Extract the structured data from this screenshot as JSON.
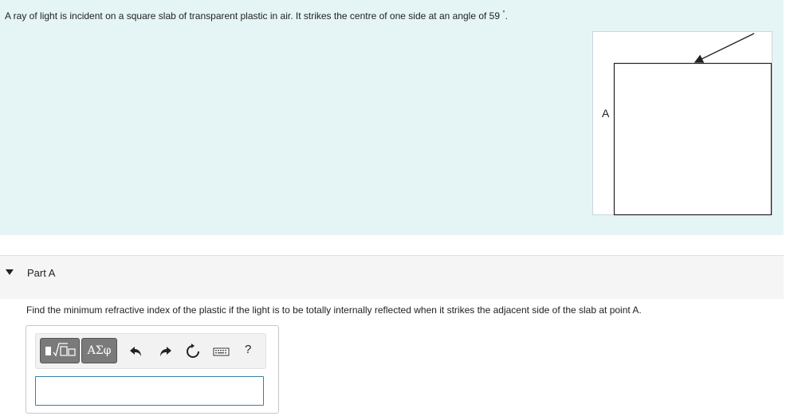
{
  "problem": {
    "text": "A ray of light is incident on a square slab of transparent plastic in air. It strikes the centre of one side at an angle of 59",
    "degree_symbol": "°",
    "end": ".",
    "figure": {
      "point_label": "A"
    }
  },
  "part": {
    "title": "Part A",
    "question": "Find the minimum refractive index of the plastic if the light is to be totally internally reflected when it strikes the adjacent side of the slab at point A."
  },
  "toolbar": {
    "templates_icon": "template-radical-icon",
    "symbols_label": "ΑΣφ",
    "undo_icon": "undo-icon",
    "redo_icon": "redo-icon",
    "reset_icon": "reset-icon",
    "keyboard_icon": "keyboard-icon",
    "help_label": "?"
  },
  "answer": {
    "value": ""
  }
}
